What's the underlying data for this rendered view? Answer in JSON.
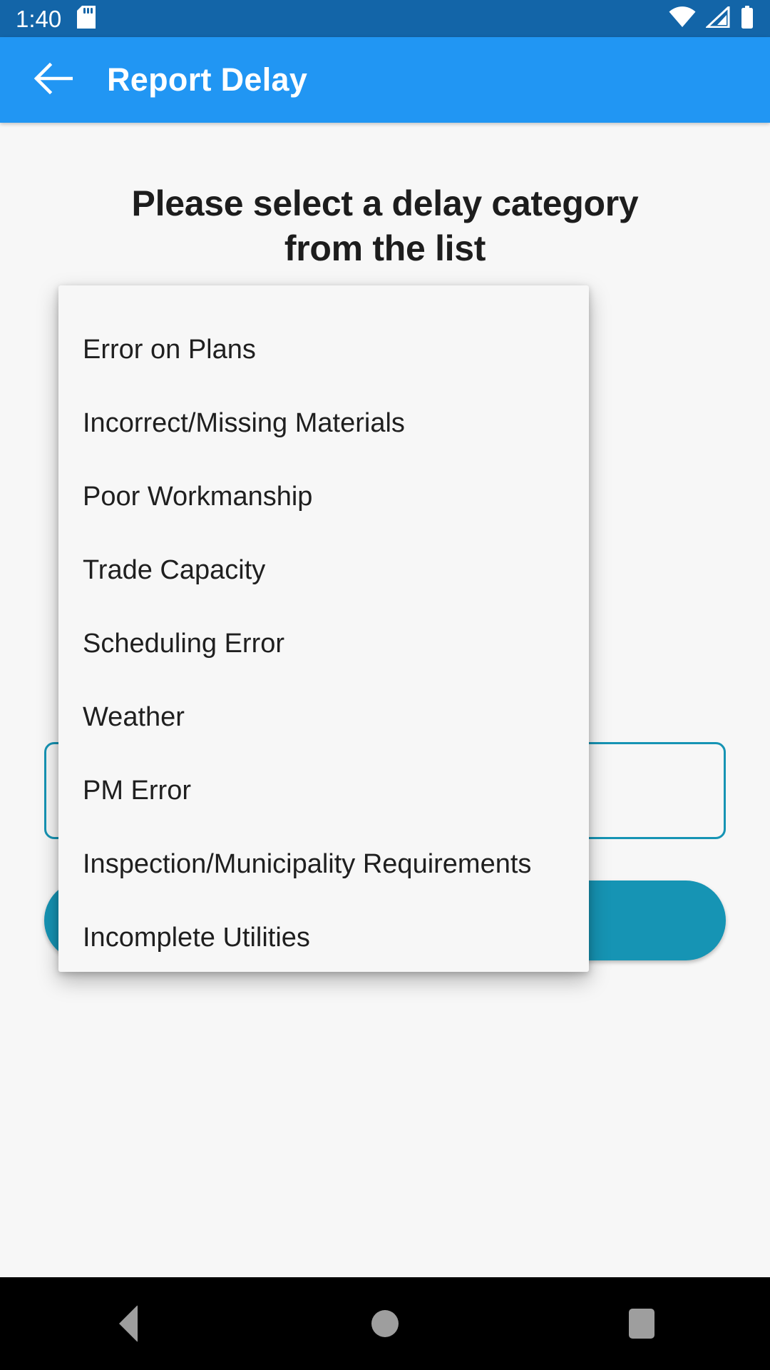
{
  "status_bar": {
    "time": "1:40",
    "icons": [
      "sd-card-icon",
      "wifi-icon",
      "cellular-signal-icon",
      "battery-icon"
    ],
    "background_color": "#1365A8"
  },
  "app_bar": {
    "title": "Report Delay",
    "back_icon": "arrow-back-icon",
    "background_color": "#2196F3"
  },
  "content": {
    "heading": "Please select a delay category from the list",
    "background_color": "#F7F7F7"
  },
  "background_controls": {
    "outlined_field_color": "#1694B4",
    "primary_button_color": "#1694B4"
  },
  "dialog": {
    "background_color": "#F7F7F7",
    "items": [
      {
        "label": "Error on Plans"
      },
      {
        "label": "Incorrect/Missing Materials"
      },
      {
        "label": "Poor Workmanship"
      },
      {
        "label": "Trade Capacity"
      },
      {
        "label": "Scheduling Error"
      },
      {
        "label": "Weather"
      },
      {
        "label": "PM Error"
      },
      {
        "label": "Inspection/Municipality Requirements"
      },
      {
        "label": "Incomplete Utilities"
      }
    ]
  },
  "nav_bar": {
    "background_color": "#000000",
    "buttons": [
      {
        "name": "back",
        "icon": "triangle-back-icon"
      },
      {
        "name": "home",
        "icon": "circle-home-icon"
      },
      {
        "name": "recents",
        "icon": "square-recents-icon"
      }
    ]
  }
}
